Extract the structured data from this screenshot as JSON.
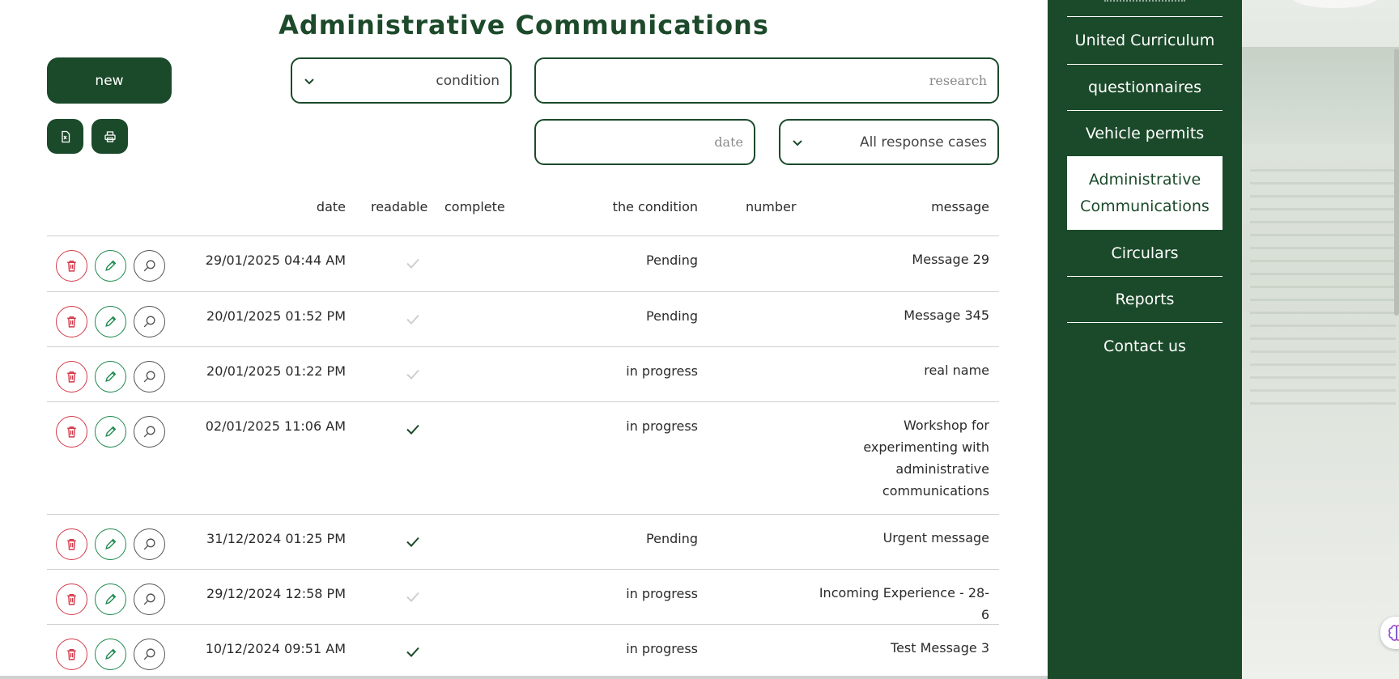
{
  "page": {
    "title": "Administrative Communications"
  },
  "toolbar": {
    "new_label": "new",
    "excel_icon": "excel-export-icon",
    "print_icon": "print-icon"
  },
  "filters": {
    "condition_label": "condition",
    "research_placeholder": "research",
    "date_placeholder": "date",
    "response_cases_label": "All response cases"
  },
  "table": {
    "headers": {
      "date": "date",
      "readable": "readable",
      "complete": "complete",
      "condition": "the condition",
      "number": "number",
      "message": "message"
    },
    "rows": [
      {
        "date": "29/01/2025 04:44 AM",
        "readable": false,
        "condition": "Pending",
        "message": "Message 29"
      },
      {
        "date": "20/01/2025 01:52 PM",
        "readable": false,
        "condition": "Pending",
        "message": "Message 345"
      },
      {
        "date": "20/01/2025 01:22 PM",
        "readable": false,
        "condition": "in progress",
        "message": "real name"
      },
      {
        "date": "02/01/2025 11:06 AM",
        "readable": true,
        "condition": "in progress",
        "message": "Workshop for experimenting with administrative communications"
      },
      {
        "date": "31/12/2024 01:25 PM",
        "readable": true,
        "condition": "Pending",
        "message": "Urgent message"
      },
      {
        "date": "29/12/2024 12:58 PM",
        "readable": false,
        "condition": "in progress",
        "message": "Incoming Experience - 28-6"
      },
      {
        "date": "10/12/2024 09:51 AM",
        "readable": true,
        "condition": "in progress",
        "message": "Test Message 3"
      }
    ]
  },
  "sidebar": {
    "items": [
      {
        "label": "United Curriculum",
        "active": false
      },
      {
        "label": "questionnaires",
        "active": false
      },
      {
        "label": "Vehicle permits",
        "active": false
      },
      {
        "label": "Administrative Communications",
        "active": true
      },
      {
        "label": "Circulars",
        "active": false
      },
      {
        "label": "Reports",
        "active": false
      },
      {
        "label": "Contact us",
        "active": false
      }
    ]
  },
  "colors": {
    "brand_green": "#1b4a2a",
    "delete_red": "#d23b4b",
    "edit_green": "#1e8a4f",
    "check_read": "#1b4a2a",
    "check_unread": "#cfcfcf"
  }
}
